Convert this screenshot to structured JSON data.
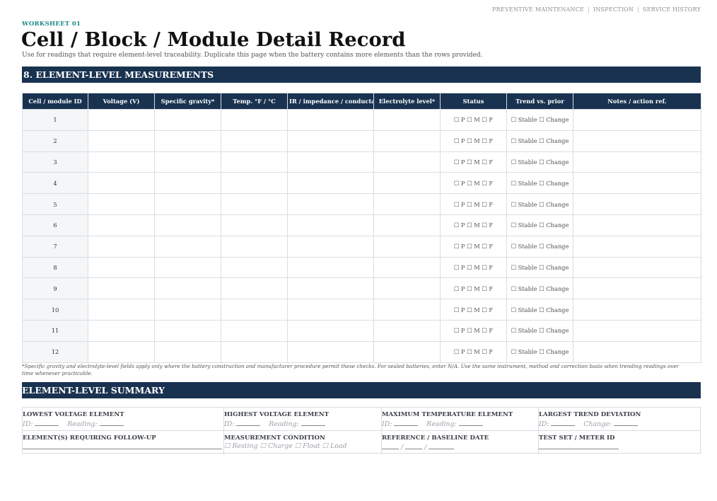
{
  "nav": {
    "items": [
      "PREVENTIVE MAINTENANCE",
      "INSPECTION",
      "SERVICE HISTORY"
    ],
    "separator": "|"
  },
  "header": {
    "kicker": "WORKSHEET 01",
    "title": "Cell / Block / Module Detail Record",
    "subtitle": "Use for readings that require element-level traceability. Duplicate this page when the battery contains more elements than the rows provided."
  },
  "section_measurements": {
    "title": "8. ELEMENT-LEVEL MEASUREMENTS",
    "columns": [
      "Cell / module ID",
      "Voltage (V)",
      "Specific gravity*",
      "Temp. °F / °C",
      "IR / impedance / conductance",
      "Electrolyte level*",
      "Status",
      "Trend vs. prior",
      "Notes / action ref."
    ],
    "rows": [
      {
        "id": "1",
        "status": "☐ P ☐ M ☐ F",
        "trend": "☐ Stable ☐ Change"
      },
      {
        "id": "2",
        "status": "☐ P ☐ M ☐ F",
        "trend": "☐ Stable ☐ Change"
      },
      {
        "id": "3",
        "status": "☐ P ☐ M ☐ F",
        "trend": "☐ Stable ☐ Change"
      },
      {
        "id": "4",
        "status": "☐ P ☐ M ☐ F",
        "trend": "☐ Stable ☐ Change"
      },
      {
        "id": "5",
        "status": "☐ P ☐ M ☐ F",
        "trend": "☐ Stable ☐ Change"
      },
      {
        "id": "6",
        "status": "☐ P ☐ M ☐ F",
        "trend": "☐ Stable ☐ Change"
      },
      {
        "id": "7",
        "status": "☐ P ☐ M ☐ F",
        "trend": "☐ Stable ☐ Change"
      },
      {
        "id": "8",
        "status": "☐ P ☐ M ☐ F",
        "trend": "☐ Stable ☐ Change"
      },
      {
        "id": "9",
        "status": "☐ P ☐ M ☐ F",
        "trend": "☐ Stable ☐ Change"
      },
      {
        "id": "10",
        "status": "☐ P ☐ M ☐ F",
        "trend": "☐ Stable ☐ Change"
      },
      {
        "id": "11",
        "status": "☐ P ☐ M ☐ F",
        "trend": "☐ Stable ☐ Change"
      },
      {
        "id": "12",
        "status": "☐ P ☐ M ☐ F",
        "trend": "☐ Stable ☐ Change"
      }
    ],
    "footnote": "*Specific gravity and electrolyte-level fields apply only where the battery construction and manufacturer procedure permit these checks. For sealed batteries, enter N/A. Use the same instrument, method and correction basis when trending readings over time whenever practicable."
  },
  "section_summary": {
    "title": "ELEMENT-LEVEL SUMMARY",
    "lowest_voltage": {
      "label": "LOWEST VOLTAGE ELEMENT",
      "id_label": "ID:",
      "second_label": "Reading:"
    },
    "highest_voltage": {
      "label": "HIGHEST VOLTAGE ELEMENT",
      "id_label": "ID:",
      "second_label": "Reading:"
    },
    "max_temperature": {
      "label": "MAXIMUM TEMPERATURE ELEMENT",
      "id_label": "ID:",
      "second_label": "Reading:"
    },
    "largest_trend": {
      "label": "LARGEST TREND DEVIATION",
      "id_label": "ID:",
      "second_label": "Change:"
    },
    "follow_up": {
      "label": "ELEMENT(S) REQUIRING FOLLOW-UP"
    },
    "measurement_condition": {
      "label": "MEASUREMENT CONDITION",
      "options": [
        "☐ Resting",
        "☐ Charge",
        "☐ Float",
        "☐ Load"
      ]
    },
    "reference_date": {
      "label": "REFERENCE / BASELINE DATE",
      "separator": "/"
    },
    "test_set": {
      "label": "TEST SET / METER ID"
    }
  },
  "colors": {
    "header_bar": "#193250",
    "kicker": "#1f8a8a",
    "border": "#d6dbe2"
  }
}
